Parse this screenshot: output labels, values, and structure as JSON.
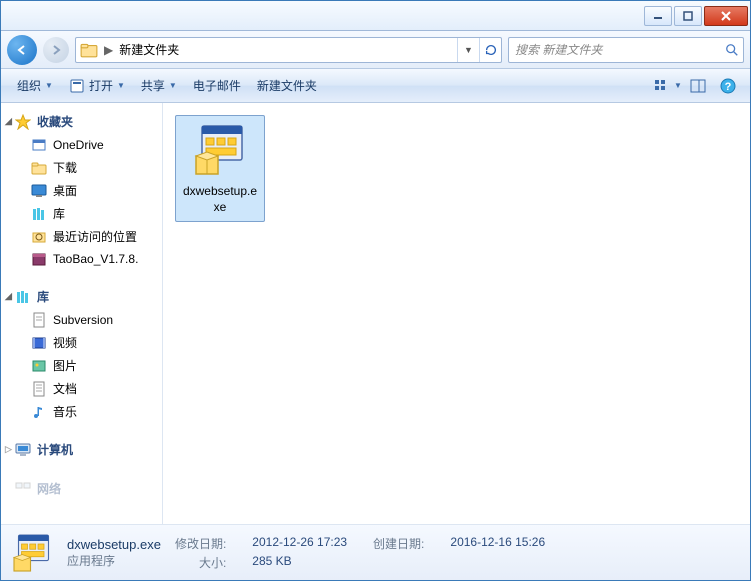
{
  "address": {
    "folder_name": "新建文件夹"
  },
  "search": {
    "placeholder": "搜索 新建文件夹"
  },
  "toolbar": {
    "organize": "组织",
    "open": "打开",
    "share": "共享",
    "email": "电子邮件",
    "new_folder": "新建文件夹"
  },
  "sidebar": {
    "favorites": {
      "title": "收藏夹",
      "items": [
        "OneDrive",
        "下载",
        "桌面",
        "库",
        "最近访问的位置",
        "TaoBao_V1.7.8."
      ]
    },
    "libraries": {
      "title": "库",
      "items": [
        "Subversion",
        "视频",
        "图片",
        "文档",
        "音乐"
      ]
    },
    "computer": {
      "title": "计算机"
    },
    "network": {
      "title": "网络"
    }
  },
  "file": {
    "name": "dxwebsetup.exe"
  },
  "details": {
    "filename": "dxwebsetup.exe",
    "type": "应用程序",
    "modified_label": "修改日期:",
    "modified_value": "2012-12-26 17:23",
    "size_label": "大小:",
    "size_value": "285 KB",
    "created_label": "创建日期:",
    "created_value": "2016-12-16 15:26"
  }
}
